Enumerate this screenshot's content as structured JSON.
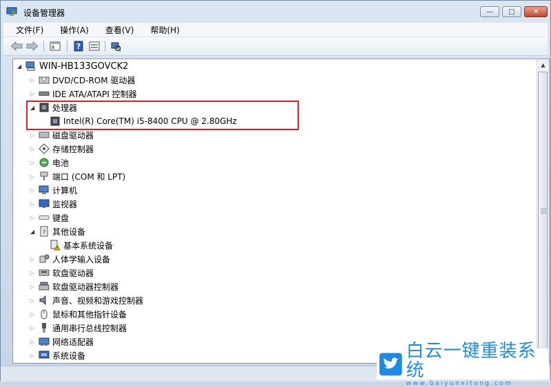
{
  "window": {
    "title": "设备管理器"
  },
  "window_controls": {
    "minimize": "—",
    "maximize": "□",
    "close": "✕"
  },
  "menu": [
    {
      "label": "文件(F)"
    },
    {
      "label": "操作(A)"
    },
    {
      "label": "查看(V)"
    },
    {
      "label": "帮助(H)"
    }
  ],
  "toolbar": {
    "back_icon": "arrow-left-icon",
    "forward_icon": "arrow-right-icon",
    "properties_icon": "properties-icon",
    "help_icon": "help-icon",
    "view_icon": "view-icon",
    "scan_icon": "scan-hardware-icon"
  },
  "tree": {
    "root": {
      "label": "WIN-HB133GOVCK2",
      "icon": "computer-icon",
      "expanded": true
    },
    "items": [
      {
        "label": "DVD/CD-ROM 驱动器",
        "icon": "dvd-drive-icon",
        "level": 1,
        "expander": "▷"
      },
      {
        "label": "IDE ATA/ATAPI 控制器",
        "icon": "ide-controller-icon",
        "level": 1,
        "expander": "▷"
      },
      {
        "label": "处理器",
        "icon": "processor-icon",
        "level": 1,
        "expander": "◢"
      },
      {
        "label": "Intel(R) Core(TM) i5-8400 CPU @ 2.80GHz",
        "icon": "processor-icon",
        "level": 2,
        "expander": ""
      },
      {
        "label": "磁盘驱动器",
        "icon": "disk-drive-icon",
        "level": 1,
        "expander": "▷"
      },
      {
        "label": "存储控制器",
        "icon": "storage-controller-icon",
        "level": 1,
        "expander": "▷"
      },
      {
        "label": "电池",
        "icon": "battery-icon",
        "level": 1,
        "expander": "▷"
      },
      {
        "label": "端口 (COM 和 LPT)",
        "icon": "port-icon",
        "level": 1,
        "expander": "▷"
      },
      {
        "label": "计算机",
        "icon": "computer-icon",
        "level": 1,
        "expander": "▷"
      },
      {
        "label": "监视器",
        "icon": "monitor-icon",
        "level": 1,
        "expander": "▷"
      },
      {
        "label": "键盘",
        "icon": "keyboard-icon",
        "level": 1,
        "expander": "▷"
      },
      {
        "label": "其他设备",
        "icon": "other-devices-icon",
        "level": 1,
        "expander": "◢"
      },
      {
        "label": "基本系统设备",
        "icon": "warning-device-icon",
        "level": 2,
        "expander": ""
      },
      {
        "label": "人体学输入设备",
        "icon": "hid-icon",
        "level": 1,
        "expander": "▷"
      },
      {
        "label": "软盘驱动器",
        "icon": "floppy-drive-icon",
        "level": 1,
        "expander": "▷"
      },
      {
        "label": "软盘驱动器控制器",
        "icon": "floppy-controller-icon",
        "level": 1,
        "expander": "▷"
      },
      {
        "label": "声音、视频和游戏控制器",
        "icon": "sound-icon",
        "level": 1,
        "expander": "▷"
      },
      {
        "label": "鼠标和其他指针设备",
        "icon": "mouse-icon",
        "level": 1,
        "expander": "▷"
      },
      {
        "label": "通用串行总线控制器",
        "icon": "usb-icon",
        "level": 1,
        "expander": "▷"
      },
      {
        "label": "网络适配器",
        "icon": "network-adapter-icon",
        "level": 1,
        "expander": "▷"
      },
      {
        "label": "系统设备",
        "icon": "system-devices-icon",
        "level": 1,
        "expander": "▷"
      }
    ]
  },
  "watermark": {
    "brand": "白云一键重装系统",
    "url": "www.baiyunxitong.com"
  },
  "colors": {
    "highlight_border": "#e11d25",
    "watermark_blue": "#1d8ae8"
  }
}
